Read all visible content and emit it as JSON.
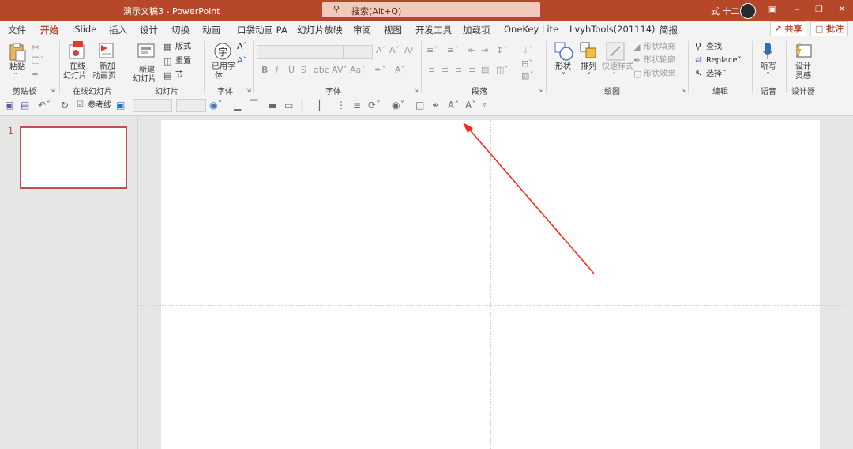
{
  "window": {
    "title": "演示文稿3  -  PowerPoint",
    "search": "搜索(Alt+Q)",
    "user": "式 十二",
    "accent": "#b7472a"
  },
  "tabs": [
    "文件",
    "开始",
    "iSlide",
    "插入",
    "设计",
    "切换",
    "动画",
    "口袋动画 PA",
    "幻灯片放映",
    "审阅",
    "视图",
    "开发工具",
    "加载项",
    "OneKey Lite",
    "LvyhTools(201114)",
    "简报"
  ],
  "actions": {
    "share": "共享",
    "comment": "批注"
  },
  "ribbon": {
    "paste": "粘贴",
    "online_slides_1": "在线",
    "online_slides_2": "幻灯片",
    "new_anim_1": "新加",
    "new_anim_2": "动画页",
    "new_slide_1": "新建",
    "new_slide_2": "幻灯片",
    "layout": "版式",
    "reset": "重置",
    "section": "节",
    "used_font_1": "已用字",
    "used_font_2": "体",
    "shapes": "形状",
    "arrange": "排列",
    "quick_styles": "快速样式",
    "shape_fill": "形状填充",
    "shape_outline": "形状轮廓",
    "shape_effects": "形状效果",
    "find": "查找",
    "replace": "Replace",
    "select": "选择",
    "dictate": "听写",
    "designer_1": "设计",
    "designer_2": "灵感",
    "groups": {
      "clipboard": "剪贴板",
      "online_slides": "在线幻灯片",
      "slides": "幻灯片",
      "font_g": "字体",
      "font": "字体",
      "paragraph": "段落",
      "drawing": "绘图",
      "editing": "编辑",
      "voice": "语音",
      "designer": "设计器"
    }
  },
  "qat": {
    "guides": "参考线"
  },
  "slides": {
    "number": "1"
  },
  "annotation": {
    "arrow_color": "#ff2a1a"
  }
}
